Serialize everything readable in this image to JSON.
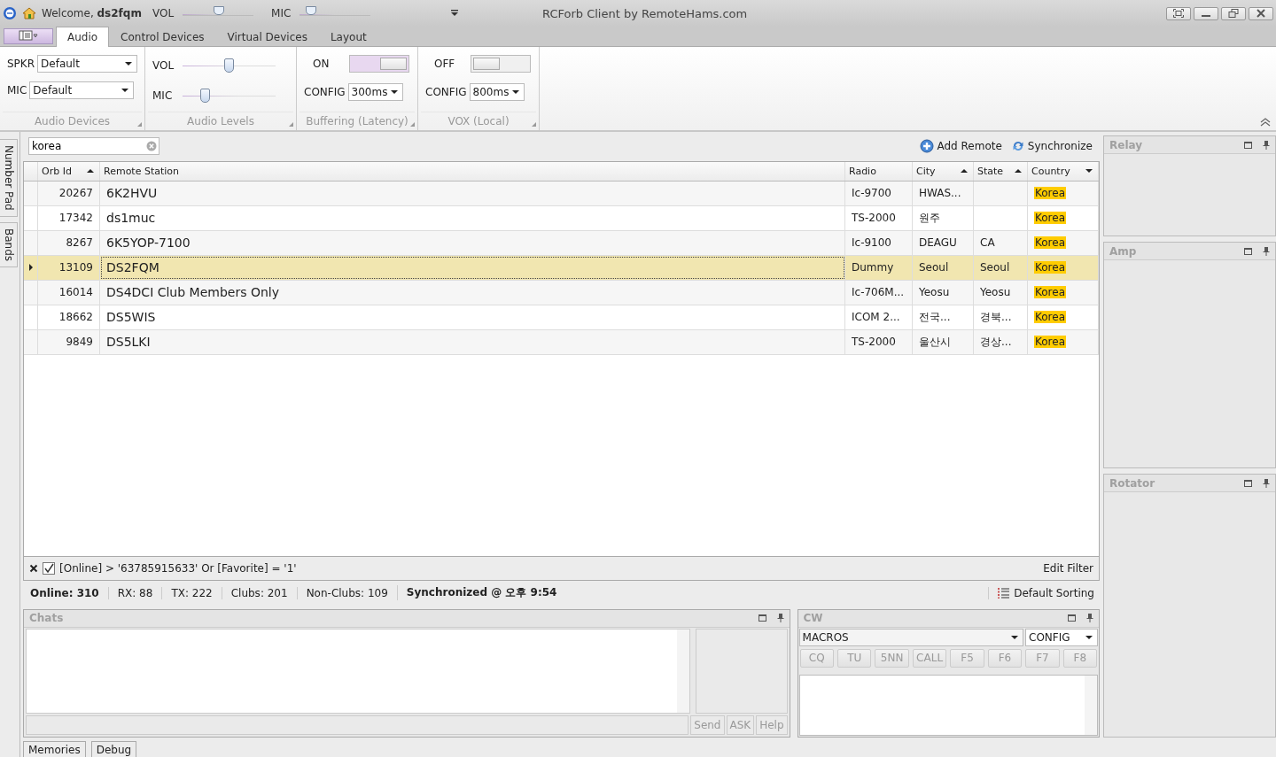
{
  "title_bar": {
    "welcome": "Welcome,",
    "user": "ds2fqm",
    "sliders": [
      {
        "label": "VOL",
        "level": 0.5
      },
      {
        "label": "MIC",
        "level": 0.15
      }
    ],
    "title": "RCForb Client by RemoteHams.com"
  },
  "ribbon_tabs": [
    {
      "label": "Audio",
      "selected": true
    },
    {
      "label": "Control Devices",
      "selected": false
    },
    {
      "label": "Virtual Devices",
      "selected": false
    },
    {
      "label": "Layout",
      "selected": false
    }
  ],
  "audio_devices": {
    "caption": "Audio Devices",
    "fields": [
      {
        "label": "SPKR",
        "value": "Default"
      },
      {
        "label": "MIC",
        "value": "Default"
      }
    ]
  },
  "audio_levels": {
    "caption": "Audio Levels",
    "sliders": [
      {
        "label": "VOL",
        "level": 0.5
      },
      {
        "label": "MIC",
        "level": 0.25
      }
    ]
  },
  "toggles": [
    {
      "caption": "Buffering (Latency)",
      "label": "ON",
      "on": true,
      "config_label": "CONFIG",
      "config_value": "300ms"
    },
    {
      "caption": "VOX (Local)",
      "label": "OFF",
      "on": false,
      "config_label": "CONFIG",
      "config_value": "800ms"
    }
  ],
  "side_tabs": [
    "Number Pad",
    "Bands"
  ],
  "search": {
    "value": "korea"
  },
  "actions": [
    {
      "label": "Add Remote",
      "kind": "add"
    },
    {
      "label": "Synchronize",
      "kind": "sync"
    }
  ],
  "table": {
    "columns": [
      {
        "label": "Orb Id",
        "sorted": true,
        "descending": false
      },
      {
        "label": "Remote Station",
        "sorted": false
      },
      {
        "label": "Radio",
        "sorted": false
      },
      {
        "label": "City",
        "sorted": true,
        "descending": false
      },
      {
        "label": "State",
        "sorted": true,
        "descending": false
      },
      {
        "label": "Country",
        "sorted": true,
        "descending": true
      }
    ],
    "rows": [
      {
        "orb_id": "20267",
        "station": "6K2HVU",
        "radio": "Ic-9700",
        "city": "HWAS...",
        "state": "",
        "country": "Korea",
        "selected": false
      },
      {
        "orb_id": "17342",
        "station": "ds1muc",
        "radio": "TS-2000",
        "city": "원주",
        "state": "",
        "country": "Korea",
        "selected": false
      },
      {
        "orb_id": "8267",
        "station": "6K5YOP-7100",
        "radio": "Ic-9100",
        "city": "DEAGU",
        "state": "CA",
        "country": "Korea",
        "selected": false
      },
      {
        "orb_id": "13109",
        "station": "DS2FQM",
        "radio": "Dummy",
        "city": "Seoul",
        "state": "Seoul",
        "country": "Korea",
        "selected": true
      },
      {
        "orb_id": "16014",
        "station": "DS4DCI Club Members Only",
        "radio": "Ic-706M...",
        "city": "Yeosu",
        "state": "Yeosu",
        "country": "Korea",
        "selected": false
      },
      {
        "orb_id": "18662",
        "station": "DS5WIS",
        "radio": "ICOM 2...",
        "city": "전국...",
        "state": "경북...",
        "country": "Korea",
        "selected": false
      },
      {
        "orb_id": "9849",
        "station": "DS5LKI",
        "radio": "TS-2000",
        "city": "울산시",
        "state": "경상...",
        "country": "Korea",
        "selected": false
      }
    ]
  },
  "filter": {
    "checked": true,
    "text": "[Online] > '63785915633' Or [Favorite] = '1'",
    "edit": "Edit Filter"
  },
  "stats": [
    {
      "text": "Online: 310",
      "bold": true
    },
    {
      "text": "RX: 88",
      "bold": false
    },
    {
      "text": "TX: 222",
      "bold": false
    },
    {
      "text": "Clubs: 201",
      "bold": false
    },
    {
      "text": "Non-Clubs: 109",
      "bold": false
    },
    {
      "text": "Synchronized @ 오후 9:54",
      "bold": true
    }
  ],
  "sorting": "Default Sorting",
  "chats": {
    "title": "Chats",
    "buttons": [
      "Send",
      "ASK",
      "Help"
    ]
  },
  "cw": {
    "title": "CW",
    "macros": "MACROS",
    "config": "CONFIG",
    "keys": [
      "CQ",
      "TU",
      "5NN",
      "CALL",
      "F5",
      "F6",
      "F7",
      "F8"
    ]
  },
  "side_panels": [
    "Relay",
    "Amp",
    "Rotator"
  ],
  "bottom_tabs": [
    "Memories",
    "Debug"
  ]
}
